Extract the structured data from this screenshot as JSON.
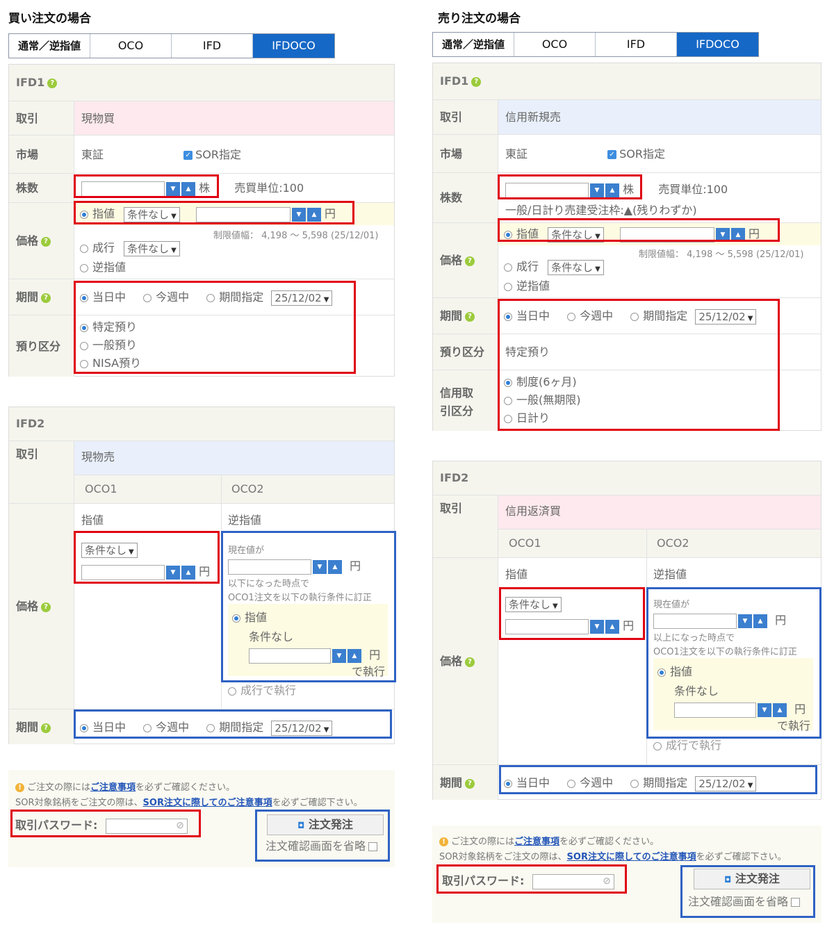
{
  "buy": {
    "heading": "買い注文の場合",
    "tabs": [
      "通常／逆指値",
      "OCO",
      "IFD",
      "IFDOCO"
    ],
    "ifd1": {
      "title": "IFD1",
      "torihiki_label": "取引",
      "torihiki_value": "現物買",
      "market_label": "市場",
      "market_value": "東証",
      "sor_label": "SOR指定",
      "qty_label": "株数",
      "qty_unit": "株",
      "lot_text": "売買単位:100",
      "price_label": "価格",
      "price_options": [
        "指値",
        "成行",
        "逆指値"
      ],
      "cond_select": "条件なし",
      "yen": "円",
      "limit_range": "制限値幅： 4,198 ～ 5,598 (25/12/01)",
      "period_label": "期間",
      "period_options": [
        "当日中",
        "今週中",
        "期間指定"
      ],
      "period_date": "25/12/02",
      "azukari_label": "預り区分",
      "azukari_options": [
        "特定預り",
        "一般預り",
        "NISA預り"
      ]
    },
    "ifd2": {
      "title": "IFD2",
      "torihiki_label": "取引",
      "torihiki_value": "現物売",
      "oco1": "OCO1",
      "oco2": "OCO2",
      "sashine": "指値",
      "gyakusashine": "逆指値",
      "price_label": "価格",
      "cond_select": "条件なし",
      "yen": "円",
      "current_price": "現在値が",
      "trigger_text": "以下になった時点で",
      "revise_text": "OCO1注文を以下の執行条件に訂正",
      "exec_sashine": "指値",
      "exec_cond": "条件なし",
      "exec_text": "で執行",
      "nariyuki_exec": "成行で執行",
      "period_label": "期間",
      "period_options": [
        "当日中",
        "今週中",
        "期間指定"
      ],
      "period_date": "25/12/02"
    },
    "notice": {
      "line1_pre": "ご注文の際には",
      "line1_link": "ご注意事項",
      "line1_post": "を必ずご確認ください。",
      "line2_pre": "SOR対象銘柄をご注文の際は、",
      "line2_link": "SOR注文に際してのご注意事項",
      "line2_post": "を必ずご確認下さい。",
      "password_label": "取引パスワード:",
      "submit_label": "注文発注",
      "skip_label": "注文確認画面を省略"
    }
  },
  "sell": {
    "heading": "売り注文の場合",
    "tabs": [
      "通常／逆指値",
      "OCO",
      "IFD",
      "IFDOCO"
    ],
    "ifd1": {
      "title": "IFD1",
      "torihiki_label": "取引",
      "torihiki_value": "信用新規売",
      "market_label": "市場",
      "market_value": "東証",
      "sor_label": "SOR指定",
      "qty_label": "株数",
      "qty_unit": "株",
      "lot_text": "売買単位:100",
      "short_text": "一般/日計り売建受注枠:▲(残りわずか)",
      "price_label": "価格",
      "price_options": [
        "指値",
        "成行",
        "逆指値"
      ],
      "cond_select": "条件なし",
      "yen": "円",
      "limit_range": "制限値幅： 4,198 ～ 5,598 (25/12/01)",
      "period_label": "期間",
      "period_options": [
        "当日中",
        "今週中",
        "期間指定"
      ],
      "period_date": "25/12/02",
      "azukari_label": "預り区分",
      "azukari_value": "特定預り",
      "shinyo_label_1": "信用取",
      "shinyo_label_2": "引区分",
      "shinyo_options": [
        "制度(6ヶ月)",
        "一般(無期限)",
        "日計り"
      ]
    },
    "ifd2": {
      "title": "IFD2",
      "torihiki_label": "取引",
      "torihiki_value": "信用返済買",
      "oco1": "OCO1",
      "oco2": "OCO2",
      "sashine": "指値",
      "gyakusashine": "逆指値",
      "price_label": "価格",
      "cond_select": "条件なし",
      "yen": "円",
      "current_price": "現在値が",
      "trigger_text": "以上になった時点で",
      "revise_text": "OCO1注文を以下の執行条件に訂正",
      "exec_sashine": "指値",
      "exec_cond": "条件なし",
      "exec_text": "で執行",
      "nariyuki_exec": "成行で執行",
      "period_label": "期間",
      "period_options": [
        "当日中",
        "今週中",
        "期間指定"
      ],
      "period_date": "25/12/02"
    },
    "notice": {
      "line1_pre": "ご注文の際には",
      "line1_link": "ご注意事項",
      "line1_post": "を必ずご確認ください。",
      "line2_pre": "SOR対象銘柄をご注文の際は、",
      "line2_link": "SOR注文に際してのご注意事項",
      "line2_post": "を必ずご確認下さい。",
      "password_label": "取引パスワード:",
      "submit_label": "注文発注",
      "skip_label": "注文確認画面を省略"
    }
  }
}
